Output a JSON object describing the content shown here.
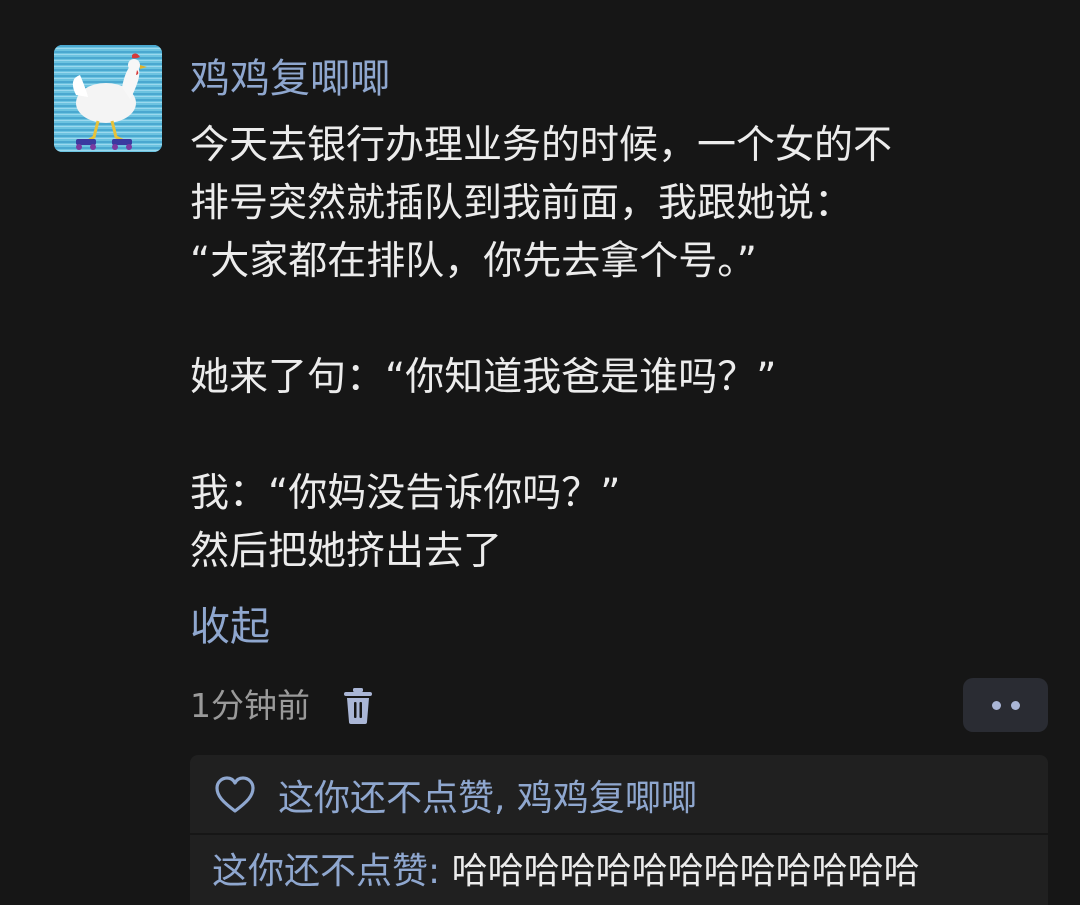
{
  "post": {
    "username": "鸡鸡复唧唧",
    "avatar_icon": "chicken-avatar",
    "lines": [
      "今天去银行办理业务的时候，一个女的不",
      "排号突然就插队到我前面，我跟她说：",
      "“大家都在排队，你先去拿个号。”",
      "",
      "她来了句：“你知道我爸是谁吗？”",
      "",
      "我：“你妈没告诉你吗？”",
      "然后把她挤出去了"
    ],
    "collapse_label": "收起",
    "time": "1分钟前",
    "delete_icon": "trash-icon",
    "more_icon": "more-dots-icon"
  },
  "reply_section": {
    "like_prompt": "这你还不点赞,",
    "like_user": "鸡鸡复唧唧",
    "heart_icon": "heart-outline-icon",
    "comments": [
      {
        "author": "这你还不点赞:",
        "text": "哈哈哈哈哈哈哈哈哈哈哈哈哈"
      }
    ]
  },
  "colors": {
    "background": "#161616",
    "link": "#8fa7cf",
    "text": "#ececec",
    "muted": "#9a9a9a",
    "panel": "#202020"
  }
}
